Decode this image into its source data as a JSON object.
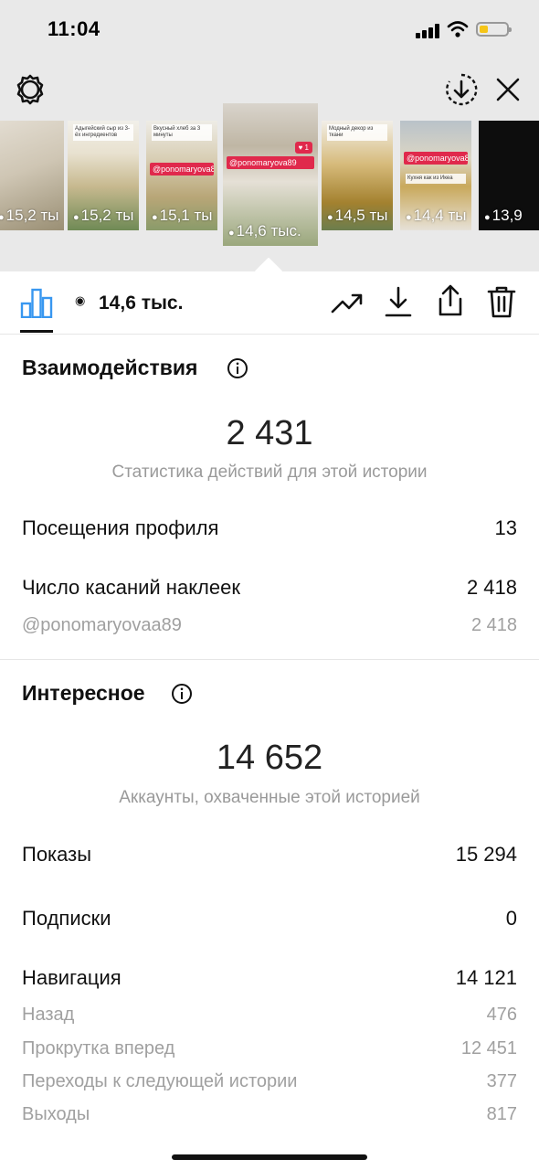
{
  "status_bar": {
    "time": "11:04"
  },
  "header": {
    "icons": [
      "settings-icon",
      "download-circle-icon",
      "close-icon"
    ]
  },
  "thumbnails": [
    {
      "views": "15,2 ты"
    },
    {
      "views": "15,2 ты",
      "caption": "Адыгейский сыр из 3-ёх ингредиентов"
    },
    {
      "views": "15,1 ты",
      "caption": "Вкусный хлеб за 3 минуты",
      "tag": "@ponomaryova89"
    },
    {
      "views": "14,6 тыс.",
      "tag": "@ponomaryova89",
      "badge": "1",
      "active": true
    },
    {
      "views": "14,5 ты",
      "caption": "Модный декор из ткани"
    },
    {
      "views": "14,4 ты",
      "tag": "@ponomaryova89",
      "caption": "Кухня как из Икеа"
    },
    {
      "views": "13,9"
    }
  ],
  "toolbar": {
    "views": "14,6 тыс.",
    "icons": [
      "chart-tab-icon",
      "eye-icon",
      "trend-icon",
      "save-icon",
      "share-icon",
      "trash-icon"
    ]
  },
  "interactions": {
    "title": "Взаимодействия",
    "total": "2 431",
    "subtitle": "Статистика действий для этой истории",
    "rows": [
      {
        "label": "Посещения профиля",
        "value": "13"
      },
      {
        "label": "Число касаний наклеек",
        "value": "2 418"
      }
    ],
    "sub_rows": [
      {
        "label": "@ponomaryovaa89",
        "value": "2 418"
      }
    ]
  },
  "discovery": {
    "title": "Интересное",
    "total": "14 652",
    "subtitle": "Аккаунты, охваченные этой историей",
    "rows": [
      {
        "label": "Показы",
        "value": "15 294"
      },
      {
        "label": "Подписки",
        "value": "0"
      },
      {
        "label": "Навигация",
        "value": "14 121"
      }
    ],
    "navigation": [
      {
        "label": "Назад",
        "value": "476"
      },
      {
        "label": "Прокрутка вперед",
        "value": "12 451"
      },
      {
        "label": "Переходы к следующей истории",
        "value": "377"
      },
      {
        "label": "Выходы",
        "value": "817"
      }
    ]
  }
}
